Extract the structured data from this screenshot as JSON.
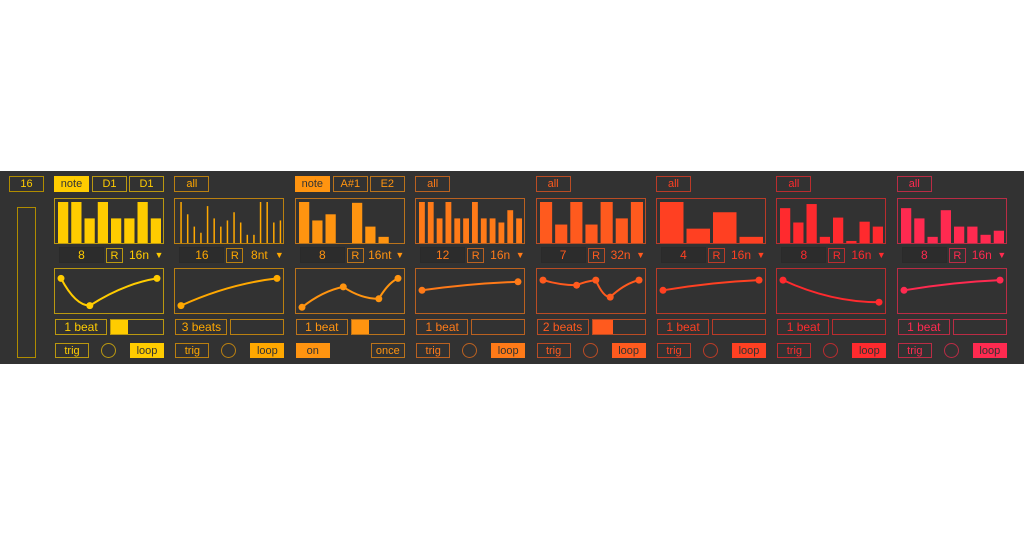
{
  "master": {
    "steps": "16"
  },
  "columns": [
    {
      "color": "#ffcc00",
      "mode": "note",
      "note_low": "D1",
      "note_high": "D1",
      "steps": "8",
      "random": "R",
      "rate": "16n",
      "bars": [
        1,
        1,
        0.6,
        1,
        0.6,
        0.6,
        1,
        0.6
      ],
      "thin": false,
      "curve": [
        [
          0,
          0.9
        ],
        [
          0.3,
          0.1
        ],
        [
          1,
          0.9
        ]
      ],
      "length": "1 beat",
      "length_fill": 0.33,
      "left": "trig",
      "right": "loop",
      "circle": true
    },
    {
      "color": "#ffa800",
      "mode": "all",
      "steps": "16",
      "random": "R",
      "rate": "8nt",
      "bars": [
        1,
        0.7,
        0.4,
        0.25,
        0.9,
        0.6,
        0.4,
        0.55,
        0.75,
        0.5,
        0.2,
        0.2,
        1,
        1,
        0.5,
        0.55
      ],
      "thin": true,
      "curve": [
        [
          0,
          0.1
        ],
        [
          1,
          0.9
        ]
      ],
      "length": "3 beats",
      "length_fill": 0,
      "left": "trig",
      "right": "loop",
      "circle": true
    },
    {
      "color": "#ff9410",
      "mode": "note",
      "note_low": "A#1",
      "note_high": "E2",
      "steps": "8",
      "random": "R",
      "rate": "16nt",
      "bars": [
        1,
        0.55,
        0.7,
        0,
        0.98,
        0.4,
        0.15,
        0
      ],
      "thin": false,
      "curve": [
        [
          0,
          0.05
        ],
        [
          0.43,
          0.65
        ],
        [
          0.8,
          0.3
        ],
        [
          1,
          0.9
        ]
      ],
      "length": "1 beat",
      "length_fill": 0.33,
      "left": "on",
      "right": "once",
      "circle": false
    },
    {
      "color": "#ff7a18",
      "mode": "all",
      "steps": "12",
      "random": "R",
      "rate": "16n",
      "bars": [
        1,
        1,
        0.6,
        1,
        0.6,
        0.6,
        1,
        0.6,
        0.6,
        0.5,
        0.8,
        0.6
      ],
      "thin": false,
      "curve": [
        [
          0,
          0.55
        ],
        [
          1,
          0.8
        ]
      ],
      "length": "1 beat",
      "length_fill": 0,
      "left": "trig",
      "right": "loop",
      "circle": true
    },
    {
      "color": "#ff5a1e",
      "mode": "all",
      "steps": "7",
      "random": "R",
      "rate": "32n",
      "bars": [
        1,
        0.45,
        1,
        0.45,
        1,
        0.6,
        1
      ],
      "thin": false,
      "curve": [
        [
          0,
          0.85
        ],
        [
          0.35,
          0.7
        ],
        [
          0.55,
          0.85
        ],
        [
          0.7,
          0.35
        ],
        [
          1,
          0.85
        ]
      ],
      "length": "2 beats",
      "length_fill": 0.4,
      "left": "trig",
      "right": "loop",
      "circle": true
    },
    {
      "color": "#ff4022",
      "mode": "all",
      "steps": "4",
      "random": "R",
      "rate": "16n",
      "bars": [
        1,
        0.35,
        0.75,
        0.15
      ],
      "thin": false,
      "curve": [
        [
          0,
          0.55
        ],
        [
          1,
          0.85
        ]
      ],
      "length": "1 beat",
      "length_fill": 0,
      "left": "trig",
      "right": "loop",
      "circle": true
    },
    {
      "color": "#ff2a2e",
      "mode": "all",
      "steps": "8",
      "random": "R",
      "rate": "16n",
      "bars": [
        0.85,
        0.5,
        0.95,
        0.15,
        0.62,
        0.05,
        0.52,
        0.4
      ],
      "thin": false,
      "curve": [
        [
          0,
          0.85
        ],
        [
          1,
          0.2
        ]
      ],
      "length": "1 beat",
      "length_fill": 0,
      "left": "trig",
      "right": "loop",
      "circle": true
    },
    {
      "color": "#ff2a50",
      "mode": "all",
      "steps": "8",
      "random": "R",
      "rate": "16n",
      "bars": [
        0.85,
        0.6,
        0.15,
        0.8,
        0.4,
        0.4,
        0.2,
        0.3
      ],
      "thin": false,
      "curve": [
        [
          0,
          0.55
        ],
        [
          1,
          0.85
        ]
      ],
      "length": "1 beat",
      "length_fill": 0,
      "left": "trig",
      "right": "loop",
      "circle": true
    }
  ]
}
